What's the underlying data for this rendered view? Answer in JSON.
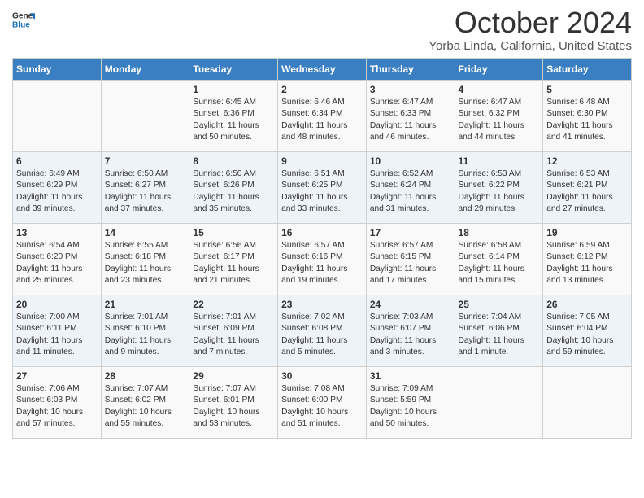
{
  "header": {
    "logo_line1": "General",
    "logo_line2": "Blue",
    "month_title": "October 2024",
    "location": "Yorba Linda, California, United States"
  },
  "days_of_week": [
    "Sunday",
    "Monday",
    "Tuesday",
    "Wednesday",
    "Thursday",
    "Friday",
    "Saturday"
  ],
  "weeks": [
    [
      {
        "day": "",
        "content": ""
      },
      {
        "day": "",
        "content": ""
      },
      {
        "day": "1",
        "content": "Sunrise: 6:45 AM\nSunset: 6:36 PM\nDaylight: 11 hours and 50 minutes."
      },
      {
        "day": "2",
        "content": "Sunrise: 6:46 AM\nSunset: 6:34 PM\nDaylight: 11 hours and 48 minutes."
      },
      {
        "day": "3",
        "content": "Sunrise: 6:47 AM\nSunset: 6:33 PM\nDaylight: 11 hours and 46 minutes."
      },
      {
        "day": "4",
        "content": "Sunrise: 6:47 AM\nSunset: 6:32 PM\nDaylight: 11 hours and 44 minutes."
      },
      {
        "day": "5",
        "content": "Sunrise: 6:48 AM\nSunset: 6:30 PM\nDaylight: 11 hours and 41 minutes."
      }
    ],
    [
      {
        "day": "6",
        "content": "Sunrise: 6:49 AM\nSunset: 6:29 PM\nDaylight: 11 hours and 39 minutes."
      },
      {
        "day": "7",
        "content": "Sunrise: 6:50 AM\nSunset: 6:27 PM\nDaylight: 11 hours and 37 minutes."
      },
      {
        "day": "8",
        "content": "Sunrise: 6:50 AM\nSunset: 6:26 PM\nDaylight: 11 hours and 35 minutes."
      },
      {
        "day": "9",
        "content": "Sunrise: 6:51 AM\nSunset: 6:25 PM\nDaylight: 11 hours and 33 minutes."
      },
      {
        "day": "10",
        "content": "Sunrise: 6:52 AM\nSunset: 6:24 PM\nDaylight: 11 hours and 31 minutes."
      },
      {
        "day": "11",
        "content": "Sunrise: 6:53 AM\nSunset: 6:22 PM\nDaylight: 11 hours and 29 minutes."
      },
      {
        "day": "12",
        "content": "Sunrise: 6:53 AM\nSunset: 6:21 PM\nDaylight: 11 hours and 27 minutes."
      }
    ],
    [
      {
        "day": "13",
        "content": "Sunrise: 6:54 AM\nSunset: 6:20 PM\nDaylight: 11 hours and 25 minutes."
      },
      {
        "day": "14",
        "content": "Sunrise: 6:55 AM\nSunset: 6:18 PM\nDaylight: 11 hours and 23 minutes."
      },
      {
        "day": "15",
        "content": "Sunrise: 6:56 AM\nSunset: 6:17 PM\nDaylight: 11 hours and 21 minutes."
      },
      {
        "day": "16",
        "content": "Sunrise: 6:57 AM\nSunset: 6:16 PM\nDaylight: 11 hours and 19 minutes."
      },
      {
        "day": "17",
        "content": "Sunrise: 6:57 AM\nSunset: 6:15 PM\nDaylight: 11 hours and 17 minutes."
      },
      {
        "day": "18",
        "content": "Sunrise: 6:58 AM\nSunset: 6:14 PM\nDaylight: 11 hours and 15 minutes."
      },
      {
        "day": "19",
        "content": "Sunrise: 6:59 AM\nSunset: 6:12 PM\nDaylight: 11 hours and 13 minutes."
      }
    ],
    [
      {
        "day": "20",
        "content": "Sunrise: 7:00 AM\nSunset: 6:11 PM\nDaylight: 11 hours and 11 minutes."
      },
      {
        "day": "21",
        "content": "Sunrise: 7:01 AM\nSunset: 6:10 PM\nDaylight: 11 hours and 9 minutes."
      },
      {
        "day": "22",
        "content": "Sunrise: 7:01 AM\nSunset: 6:09 PM\nDaylight: 11 hours and 7 minutes."
      },
      {
        "day": "23",
        "content": "Sunrise: 7:02 AM\nSunset: 6:08 PM\nDaylight: 11 hours and 5 minutes."
      },
      {
        "day": "24",
        "content": "Sunrise: 7:03 AM\nSunset: 6:07 PM\nDaylight: 11 hours and 3 minutes."
      },
      {
        "day": "25",
        "content": "Sunrise: 7:04 AM\nSunset: 6:06 PM\nDaylight: 11 hours and 1 minute."
      },
      {
        "day": "26",
        "content": "Sunrise: 7:05 AM\nSunset: 6:04 PM\nDaylight: 10 hours and 59 minutes."
      }
    ],
    [
      {
        "day": "27",
        "content": "Sunrise: 7:06 AM\nSunset: 6:03 PM\nDaylight: 10 hours and 57 minutes."
      },
      {
        "day": "28",
        "content": "Sunrise: 7:07 AM\nSunset: 6:02 PM\nDaylight: 10 hours and 55 minutes."
      },
      {
        "day": "29",
        "content": "Sunrise: 7:07 AM\nSunset: 6:01 PM\nDaylight: 10 hours and 53 minutes."
      },
      {
        "day": "30",
        "content": "Sunrise: 7:08 AM\nSunset: 6:00 PM\nDaylight: 10 hours and 51 minutes."
      },
      {
        "day": "31",
        "content": "Sunrise: 7:09 AM\nSunset: 5:59 PM\nDaylight: 10 hours and 50 minutes."
      },
      {
        "day": "",
        "content": ""
      },
      {
        "day": "",
        "content": ""
      }
    ]
  ]
}
